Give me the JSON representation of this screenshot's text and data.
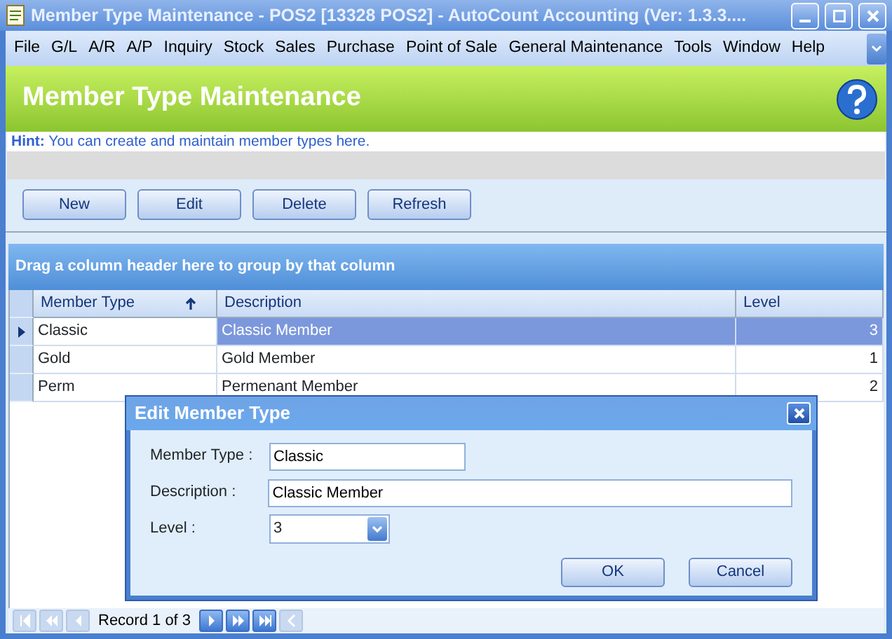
{
  "window": {
    "title": "Member Type Maintenance - POS2 [13328 POS2] - AutoCount Accounting (Ver: 1.3.3...."
  },
  "menu": [
    "File",
    "G/L",
    "A/R",
    "A/P",
    "Inquiry",
    "Stock",
    "Sales",
    "Purchase",
    "Point of Sale",
    "General Maintenance",
    "Tools",
    "Window",
    "Help"
  ],
  "header": {
    "title": "Member Type Maintenance"
  },
  "hint": {
    "label": "Hint:",
    "text": "You can create and maintain member types here."
  },
  "toolbar": [
    "New",
    "Edit",
    "Delete",
    "Refresh"
  ],
  "grid": {
    "group_panel": "Drag a column header here to group by that column",
    "columns": [
      {
        "label": "Member Type",
        "sorted": true
      },
      {
        "label": "Description",
        "sorted": false
      },
      {
        "label": "Level",
        "sorted": false
      }
    ],
    "rows": [
      {
        "cells": [
          "Classic",
          "Classic Member",
          "3"
        ],
        "selected": true
      },
      {
        "cells": [
          "Gold",
          "Gold Member",
          "1"
        ],
        "selected": false
      },
      {
        "cells": [
          "Perm",
          "Permenant Member",
          "2"
        ],
        "selected": false
      }
    ]
  },
  "navigator": {
    "buttons_before": [
      {
        "kind": "first",
        "disabled": true
      },
      {
        "kind": "prev_page",
        "disabled": true
      },
      {
        "kind": "prev",
        "disabled": true
      }
    ],
    "record": "Record 1 of 3",
    "buttons_after": [
      {
        "kind": "next",
        "disabled": false
      },
      {
        "kind": "next_page",
        "disabled": false
      },
      {
        "kind": "last",
        "disabled": false
      },
      {
        "kind": "back",
        "disabled": true
      }
    ]
  },
  "dialog": {
    "title": "Edit Member Type",
    "fields": [
      {
        "label": "Member Type :",
        "value": "Classic",
        "kind": "text"
      },
      {
        "label": "Description :",
        "value": "Classic Member",
        "kind": "text"
      },
      {
        "label": "Level :",
        "value": "3",
        "kind": "combo"
      }
    ],
    "buttons": [
      "OK",
      "Cancel"
    ]
  }
}
